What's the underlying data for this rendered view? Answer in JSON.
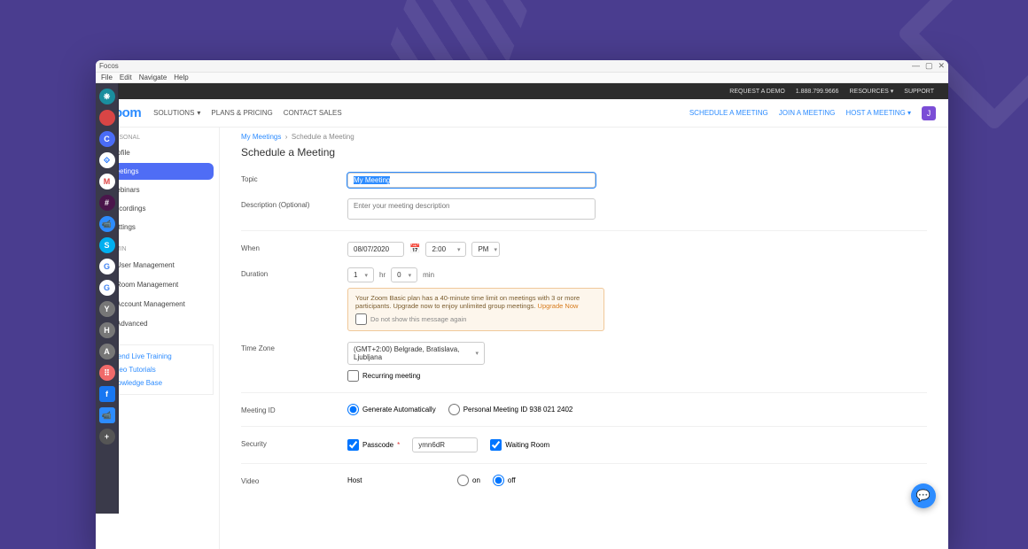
{
  "os": {
    "title": "Focos",
    "menus": [
      "File",
      "Edit",
      "Navigate",
      "Help"
    ],
    "controls": {
      "min": "—",
      "max": "▢",
      "close": "✕"
    }
  },
  "topbar": {
    "demo": "REQUEST A DEMO",
    "phone": "1.888.799.9666",
    "resources": "RESOURCES",
    "support": "SUPPORT"
  },
  "header": {
    "logo": "zoom",
    "nav": {
      "solutions": "SOLUTIONS",
      "plans": "PLANS & PRICING",
      "contact": "CONTACT SALES"
    },
    "right": {
      "schedule": "SCHEDULE A MEETING",
      "join": "JOIN A MEETING",
      "host": "HOST A MEETING"
    },
    "avatar": "J"
  },
  "sidebar": {
    "personal_head": "PERSONAL",
    "items": [
      "Profile",
      "Meetings",
      "Webinars",
      "Recordings",
      "Settings"
    ],
    "active_index": 1,
    "admin_head": "ADMIN",
    "admin_items": [
      "User Management",
      "Room Management",
      "Account Management",
      "Advanced"
    ],
    "help": [
      "Attend Live Training",
      "Video Tutorials",
      "Knowledge Base"
    ]
  },
  "breadcrumb": {
    "root": "My Meetings",
    "current": "Schedule a Meeting"
  },
  "page_title": "Schedule a Meeting",
  "form": {
    "topic_label": "Topic",
    "topic_value": "My Meeting",
    "desc_label": "Description (Optional)",
    "desc_placeholder": "Enter your meeting description",
    "when_label": "When",
    "date": "08/07/2020",
    "time": "2:00",
    "ampm": "PM",
    "duration_label": "Duration",
    "dur_hr": "1",
    "dur_hr_unit": "hr",
    "dur_min": "0",
    "dur_min_unit": "min",
    "banner_text": "Your Zoom Basic plan has a 40-minute time limit on meetings with 3 or more participants. Upgrade now to enjoy unlimited group meetings.",
    "banner_link": "Upgrade Now",
    "banner_check": "Do not show this message again",
    "tz_label": "Time Zone",
    "tz_value": "(GMT+2:00) Belgrade, Bratislava, Ljubljana",
    "recurring": "Recurring meeting",
    "meeting_id_label": "Meeting ID",
    "mid_auto": "Generate Automatically",
    "mid_personal": "Personal Meeting ID 938 021 2402",
    "security_label": "Security",
    "passcode_label": "Passcode",
    "passcode_value": "ymn6dR",
    "waiting_room": "Waiting Room",
    "video_label": "Video",
    "video_host": "Host",
    "on": "on",
    "off": "off"
  },
  "dock": [
    {
      "bg": "#1a8e9e",
      "txt": "❋"
    },
    {
      "bg": "#d94545",
      "txt": ""
    },
    {
      "bg": "#4a6cf7",
      "txt": "C"
    },
    {
      "bg": "#ffffff",
      "txt": "⟐",
      "fg": "#0061ff"
    },
    {
      "bg": "#ffffff",
      "txt": "M",
      "fg": "#d44"
    },
    {
      "bg": "#4a154b",
      "txt": "#"
    },
    {
      "bg": "#2d8cff",
      "txt": "📹"
    },
    {
      "bg": "#00aff0",
      "txt": "S"
    },
    {
      "bg": "#ffffff",
      "txt": "G",
      "fg": "#4285f4"
    },
    {
      "bg": "#ffffff",
      "txt": "G",
      "fg": "#4285f4"
    },
    {
      "bg": "#777",
      "txt": "Y"
    },
    {
      "bg": "#777",
      "txt": "H"
    },
    {
      "bg": "#777",
      "txt": "A"
    },
    {
      "bg": "#f06a6a",
      "txt": "⠿"
    },
    {
      "bg": "#1877f2",
      "txt": "f",
      "sq": true
    },
    {
      "bg": "#2d8cff",
      "txt": "📹",
      "sq": true
    },
    {
      "bg": "#555",
      "txt": "+"
    }
  ]
}
